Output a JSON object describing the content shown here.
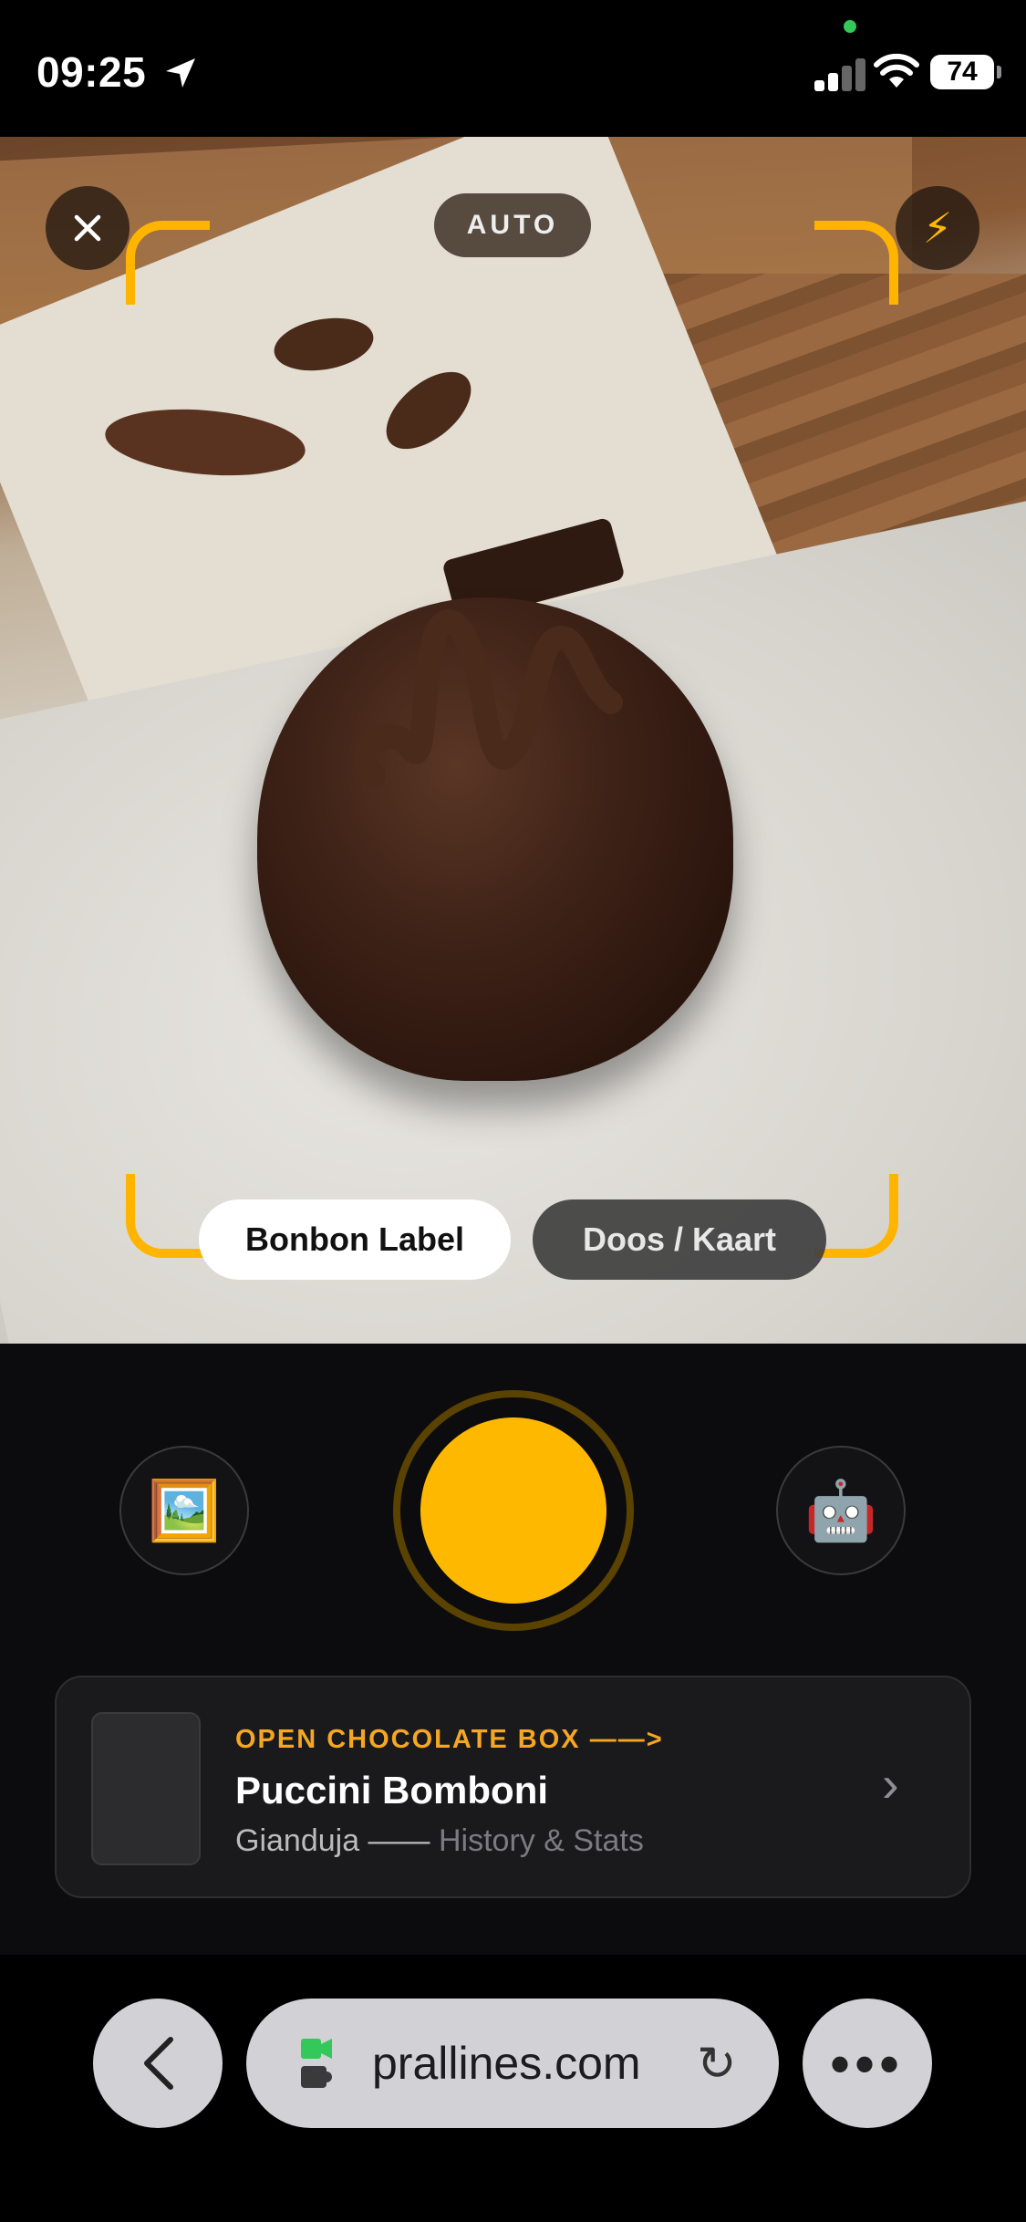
{
  "status_bar": {
    "time": "09:25",
    "battery": "74"
  },
  "camera": {
    "mode_label": "AUTO",
    "close_icon": "close-icon",
    "flash_icon": "lightning-icon",
    "scan_modes": [
      {
        "label": "Bonbon Label",
        "active": true
      },
      {
        "label": "Doos / Kaart",
        "active": false
      }
    ],
    "accent_color": "#ffb800"
  },
  "controls": {
    "gallery_icon": "framed-picture-icon",
    "robot_icon": "robot-icon"
  },
  "result_card": {
    "kicker": "OPEN CHOCOLATE BOX ——>",
    "title": "Puccini Bomboni",
    "subtitle_primary": "Gianduja ——",
    "subtitle_secondary": "History & Stats"
  },
  "browser": {
    "url": "prallines.com"
  }
}
